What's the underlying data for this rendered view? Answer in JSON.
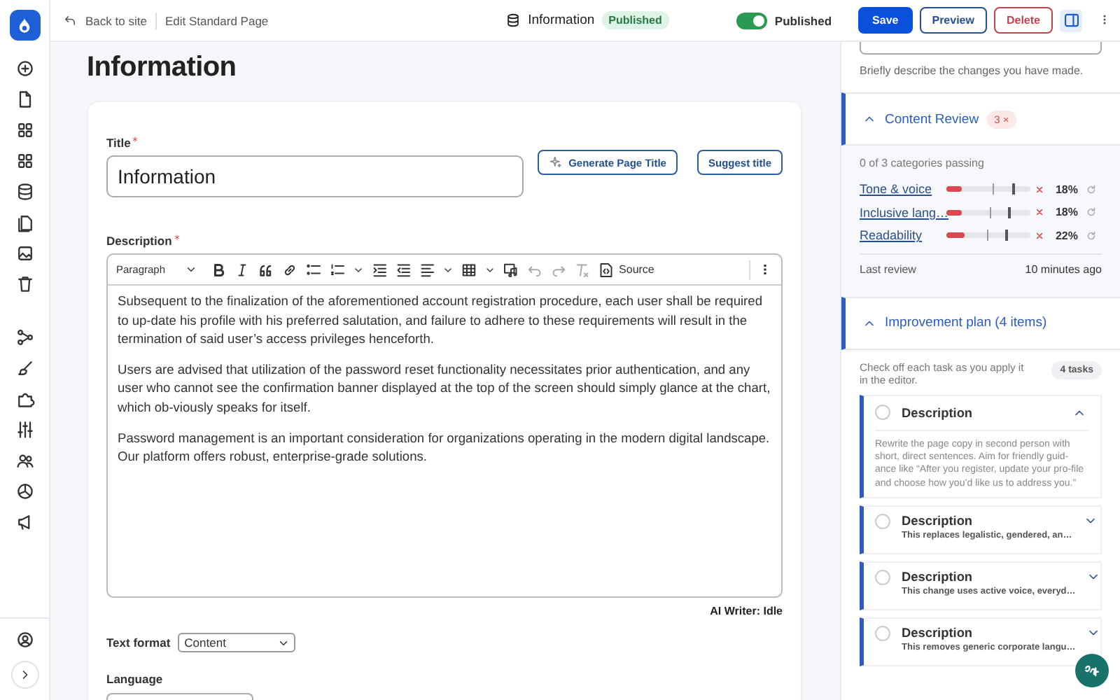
{
  "topbar": {
    "back": "Back to site",
    "breadcrumb": "Edit Standard Page",
    "doc_title": "Information",
    "status": "Published",
    "toggle": {
      "on": true,
      "label": "Published"
    },
    "buttons": [
      {
        "label": "Save",
        "kind": "primary"
      },
      {
        "label": "Preview",
        "kind": "outline"
      },
      {
        "label": "Delete",
        "kind": "danger"
      }
    ],
    "panel_toggle": {
      "on": true
    }
  },
  "page_heading": "Information",
  "form": {
    "title_label": "Title",
    "title_required": true,
    "title_value": "Information",
    "title_actions": [
      {
        "label": "Generate Page Title",
        "kind": "ai"
      },
      {
        "label": "Suggest title",
        "kind": "plain"
      }
    ],
    "description_label": "Description",
    "description_required": true,
    "editor": {
      "block_style": "Paragraph",
      "source_label": "Source",
      "paragraphs": [
        "Subsequent to the finalization of the aforementioned account registration procedure, each user shall be required to up-date his profile with his preferred salutation, and failure to adhere to these requirements will result in the termination of said user’s access privileges henceforth.",
        "Users are advised that utilization of the password reset functionality necessitates prior authentication, and any user who cannot see the confirmation banner displayed at the top of the screen should simply glance at the chart, which ob-viously speaks for itself.",
        "Password management is an important consideration for organizations operating in the modern digital landscape. Our platform offers robust, enterprise-grade solutions."
      ]
    },
    "ai_status": "AI Writer: Idle",
    "text_format": {
      "label": "Text format",
      "value": "Content"
    },
    "language": {
      "label": "Language"
    }
  },
  "right_panel": {
    "revision_hint": "Briefly describe the changes you have made.",
    "content_review": {
      "title": "Content Review",
      "expanded": true,
      "badge": "3 ×",
      "passing": "0 of 3 categories passing",
      "categories": [
        {
          "name": "Tone & voice",
          "level": 0.18,
          "reading": "18%"
        },
        {
          "name": "Inclusive lang…",
          "level": 0.18,
          "reading": "18%"
        },
        {
          "name": "Readability",
          "level": 0.22,
          "reading": "22%"
        }
      ],
      "last_review_label": "Last review",
      "last_review_value": "10 minutes ago"
    },
    "plan": {
      "title": "Improvement plan (4 items)",
      "expanded": true,
      "intro": "Check off each task as you apply it in the editor.",
      "count": "4 tasks",
      "tasks": [
        {
          "title": "Description",
          "checked": false,
          "expanded": true,
          "body": "Rewrite the page copy in second person with short, direct sentences. Aim for friendly guid-ance like “After you register, update your pro-file and choose how you’d like us to address you.”"
        },
        {
          "title": "Description",
          "checked": false,
          "expanded": false,
          "summary": "This replaces legalistic, gendered, an…"
        },
        {
          "title": "Description",
          "checked": false,
          "expanded": false,
          "summary": "This change uses active voice, everyd…"
        },
        {
          "title": "Description",
          "checked": false,
          "expanded": false,
          "summary": "This removes generic corporate langu…"
        }
      ]
    }
  }
}
